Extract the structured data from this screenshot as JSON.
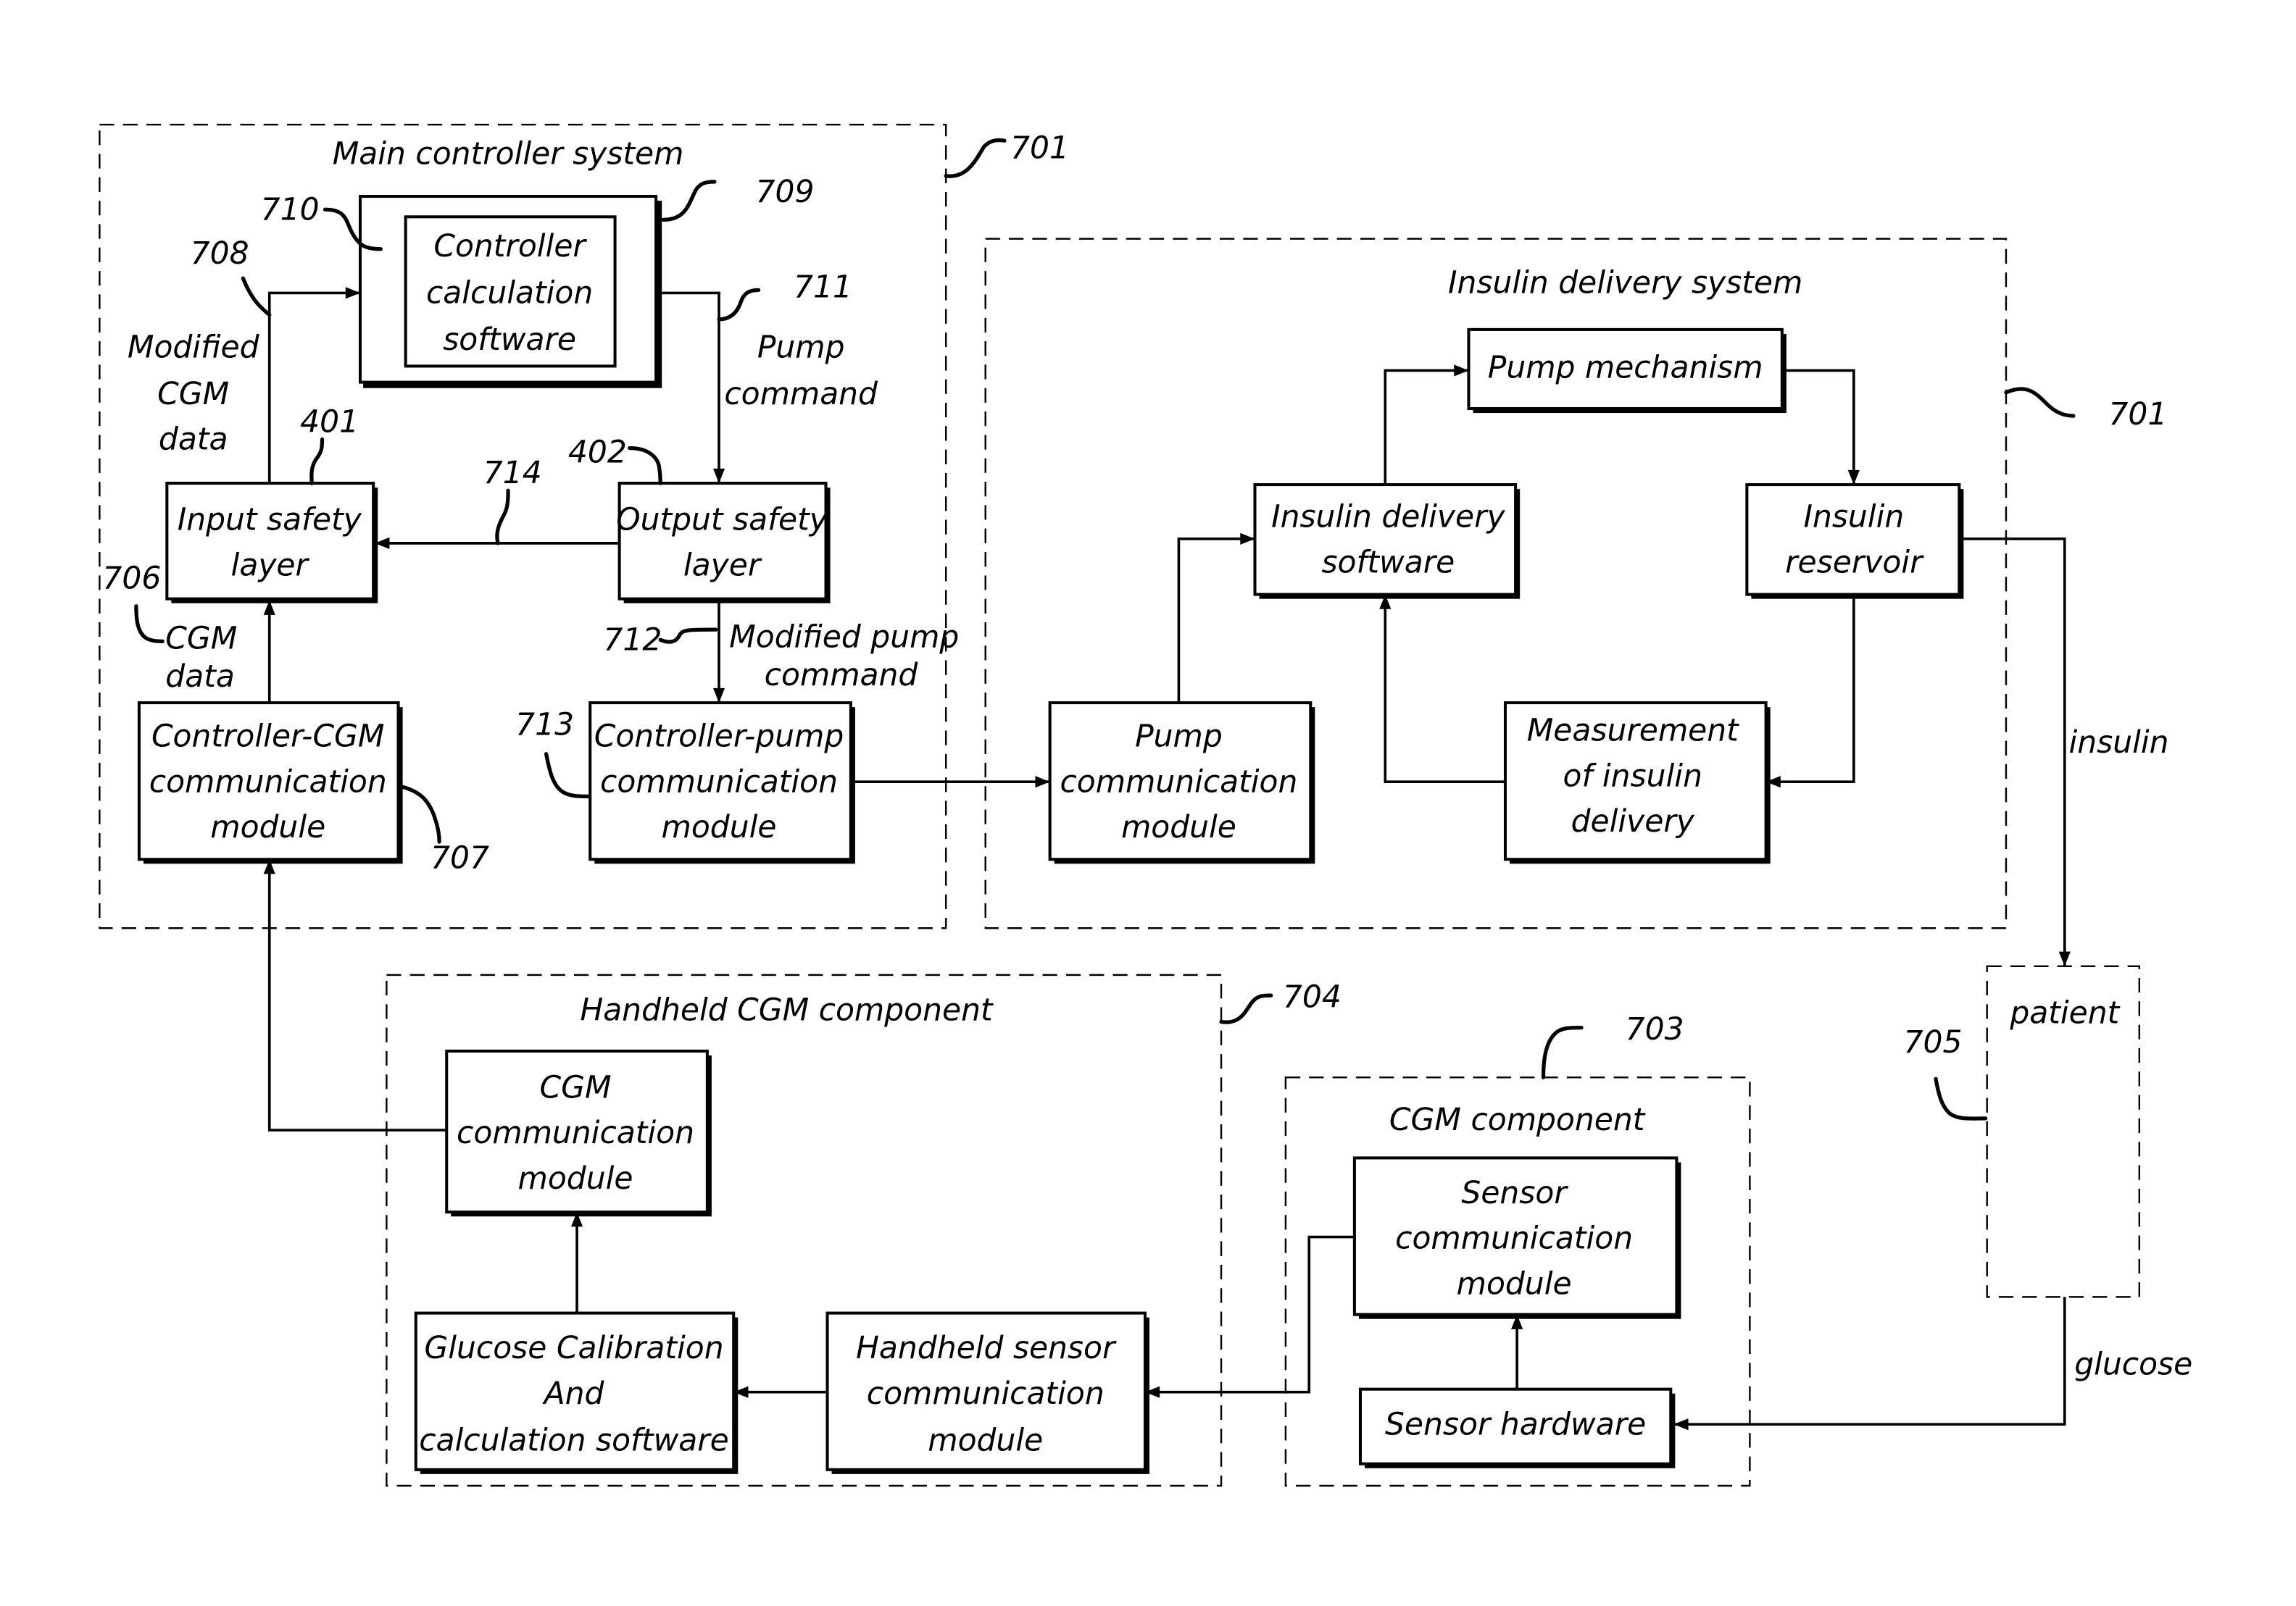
{
  "figure": {
    "systems": {
      "main_controller": {
        "title": "Main controller system",
        "ref": "701"
      },
      "insulin_delivery": {
        "title": "Insulin delivery system",
        "ref": "701"
      },
      "handheld_cgm": {
        "title": "Handheld CGM component",
        "ref": "704"
      },
      "cgm_component": {
        "title": "CGM component",
        "ref": "703"
      },
      "patient": {
        "title": "patient",
        "ref": "705"
      }
    },
    "blocks": {
      "controller_outer": {
        "ref": "709"
      },
      "controller_calc": {
        "lines": [
          "Controller",
          "calculation",
          "software"
        ],
        "ref": "710"
      },
      "input_safety": {
        "lines": [
          "Input safety",
          "layer"
        ],
        "ref": "401"
      },
      "output_safety": {
        "lines": [
          "Output safety",
          "layer"
        ],
        "ref": "402"
      },
      "controller_cgm_comm": {
        "lines": [
          "Controller-CGM",
          "communication",
          "module"
        ],
        "ref": "707"
      },
      "controller_pump_comm": {
        "lines": [
          "Controller-pump",
          "communication",
          "module"
        ],
        "ref": "713"
      },
      "pump_mechanism": {
        "lines": [
          "Pump mechanism"
        ]
      },
      "insulin_delivery_sw": {
        "lines": [
          "Insulin delivery",
          "software"
        ]
      },
      "insulin_reservoir": {
        "lines": [
          "Insulin",
          "reservoir"
        ]
      },
      "pump_comm": {
        "lines": [
          "Pump",
          "communication",
          "module"
        ]
      },
      "measurement": {
        "lines": [
          "Measurement",
          "of insulin",
          "delivery"
        ]
      },
      "cgm_comm": {
        "lines": [
          "CGM",
          "communication",
          "module"
        ]
      },
      "glucose_calib": {
        "lines": [
          "Glucose Calibration",
          "And",
          "calculation software"
        ]
      },
      "handheld_sensor_comm": {
        "lines": [
          "Handheld sensor",
          "communication",
          "module"
        ]
      },
      "sensor_comm": {
        "lines": [
          "Sensor",
          "communication",
          "module"
        ]
      },
      "sensor_hw": {
        "lines": [
          "Sensor hardware"
        ]
      }
    },
    "signals": {
      "modified_cgm": {
        "lines": [
          "Modified",
          "CGM",
          "data"
        ],
        "ref": "708"
      },
      "pump_command": {
        "lines": [
          "Pump",
          "command"
        ],
        "ref": "711"
      },
      "feedback": {
        "ref": "714"
      },
      "cgm_data": {
        "lines": [
          "CGM",
          "data"
        ],
        "ref": "706"
      },
      "modified_pump_command": {
        "lines": [
          "Modified pump",
          "command"
        ],
        "ref": "712"
      },
      "insulin": {
        "label": "insulin"
      },
      "glucose": {
        "label": "glucose"
      }
    }
  }
}
